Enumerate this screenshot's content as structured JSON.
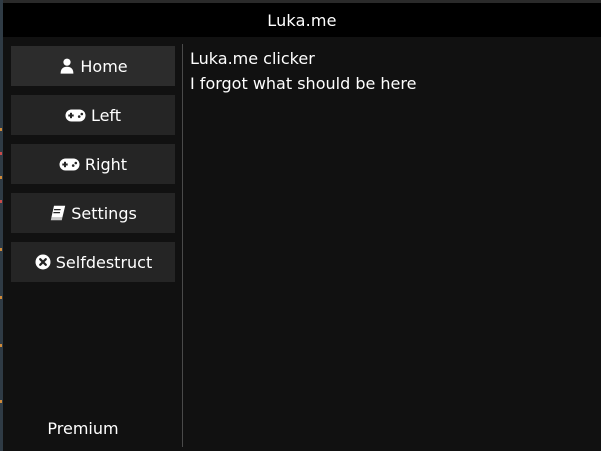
{
  "window": {
    "title": "Luka.me"
  },
  "sidebar": {
    "items": [
      {
        "label": "Home",
        "icon": "user-icon"
      },
      {
        "label": "Left",
        "icon": "gamepad-icon"
      },
      {
        "label": "Right",
        "icon": "gamepad-icon"
      },
      {
        "label": "Settings",
        "icon": "book-icon"
      },
      {
        "label": "Selfdestruct",
        "icon": "close-circle-icon"
      }
    ],
    "active_index": 0,
    "footer_label": "Premium"
  },
  "main": {
    "heading": "Luka.me clicker",
    "text": "I forgot what should be here"
  },
  "colors": {
    "titlebar": "#000000",
    "window_bg": "#111111",
    "button_bg": "#252525",
    "button_active_bg": "#2c2c2c",
    "text": "#ffffff"
  }
}
